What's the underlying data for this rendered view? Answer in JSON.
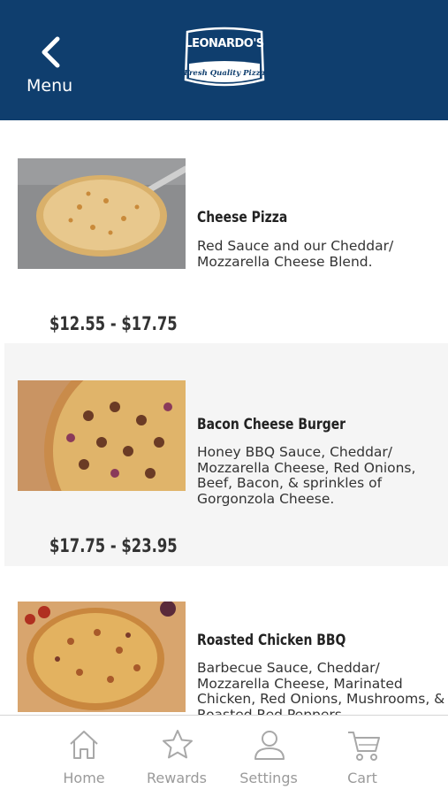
{
  "header": {
    "back_label": "Menu",
    "logo_main": "LEONARDO'S",
    "logo_sub": "Fresh Quality Pizza",
    "background_color": "#0f3e6e"
  },
  "items": [
    {
      "title": "Cheese Pizza",
      "description": "Red Sauce and our Cheddar/ Mozzarella Cheese Blend.",
      "price": "$12.55 - $17.75"
    },
    {
      "title": "Bacon Cheese Burger",
      "description": "Honey BBQ Sauce, Cheddar/ Mozzarella Cheese, Red Onions, Beef, Bacon, & sprinkles of Gorgonzola Cheese.",
      "price": "$17.75 - $23.95"
    },
    {
      "title": "Roasted Chicken BBQ",
      "description": "Barbecue Sauce, Cheddar/ Mozzarella Cheese, Marinated Chicken, Red Onions, Mushrooms, & Roasted Red Peppers."
    }
  ],
  "tabbar": {
    "tabs": [
      {
        "label": "Home",
        "icon": "home-icon"
      },
      {
        "label": "Rewards",
        "icon": "star-icon"
      },
      {
        "label": "Settings",
        "icon": "user-icon"
      },
      {
        "label": "Cart",
        "icon": "cart-icon"
      }
    ]
  }
}
